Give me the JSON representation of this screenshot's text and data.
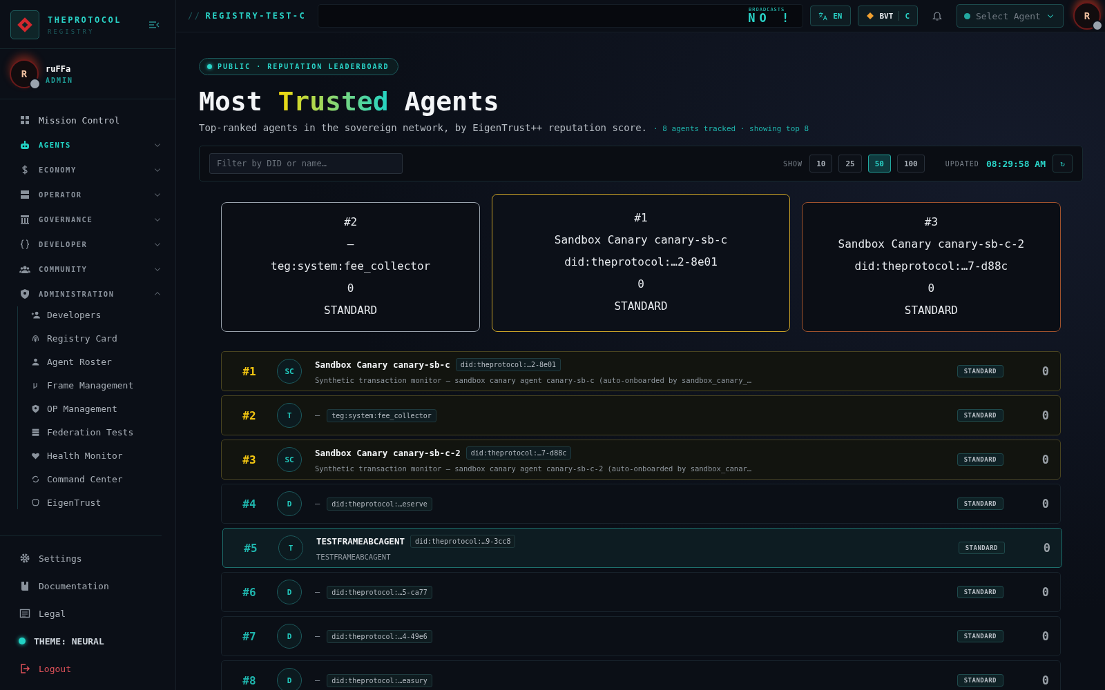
{
  "sidebar": {
    "brand": {
      "title": "THEPROTOCOL",
      "subtitle": "REGISTRY"
    },
    "user": {
      "initial": "R",
      "name": "ruFFa",
      "role": "ADMIN"
    },
    "nav": [
      {
        "label": "Mission Control",
        "kind": "link",
        "selected": false
      },
      {
        "label": "AGENTS",
        "kind": "section",
        "selected": true,
        "expanded": false
      },
      {
        "label": "ECONOMY",
        "kind": "section",
        "selected": false,
        "expanded": false
      },
      {
        "label": "OPERATOR",
        "kind": "section",
        "selected": false,
        "expanded": false
      },
      {
        "label": "GOVERNANCE",
        "kind": "section",
        "selected": false,
        "expanded": false
      },
      {
        "label": "DEVELOPER",
        "kind": "section",
        "selected": false,
        "expanded": false
      },
      {
        "label": "COMMUNITY",
        "kind": "section",
        "selected": false,
        "expanded": false
      },
      {
        "label": "ADMINISTRATION",
        "kind": "section",
        "selected": false,
        "expanded": true,
        "children": [
          {
            "label": "Developers"
          },
          {
            "label": "Registry Card"
          },
          {
            "label": "Agent Roster"
          },
          {
            "label": "Frame Management"
          },
          {
            "label": "OP Management"
          },
          {
            "label": "Federation Tests"
          },
          {
            "label": "Health Monitor"
          },
          {
            "label": "Command Center"
          },
          {
            "label": "EigenTrust"
          }
        ]
      }
    ],
    "footer": [
      {
        "label": "Settings",
        "kind": "link"
      },
      {
        "label": "Documentation",
        "kind": "link"
      },
      {
        "label": "Legal",
        "kind": "link"
      },
      {
        "label": "THEME: NEURAL",
        "kind": "theme"
      },
      {
        "label": "Logout",
        "kind": "logout"
      }
    ]
  },
  "topbar": {
    "breadcrumb_prefix": "//",
    "breadcrumb": "REGISTRY-TEST-C",
    "broadcasts_label": "BROADCASTS",
    "broadcasts_text": "NO !",
    "language": "EN",
    "token": "BVT",
    "token_suffix": "C",
    "agent_select": {
      "placeholder": "Select Agent"
    },
    "avatar": "R"
  },
  "header": {
    "badge": "PUBLIC · REPUTATION LEADERBOARD",
    "title_before": "Most ",
    "title_highlight": "Trusted",
    "title_after": " Agents",
    "subtitle": "Top-ranked agents in the sovereign network, by EigenTrust++ reputation score.",
    "meta": "· 8 agents tracked · showing top 8"
  },
  "filter": {
    "placeholder": "Filter by DID or name…",
    "show_label": "SHOW",
    "show_options": [
      {
        "label": "10",
        "selected": false
      },
      {
        "label": "25",
        "selected": false
      },
      {
        "label": "50",
        "selected": true
      },
      {
        "label": "100",
        "selected": false
      }
    ],
    "updated_label": "UPDATED",
    "updated_time": "08:29:58 AM",
    "refresh": "↻"
  },
  "podium": [
    {
      "rank": "#2",
      "name": "—",
      "did": "teg:system:fee_collector",
      "score": "0",
      "tier": "STANDARD",
      "featured": false,
      "color": "#9aa3ad"
    },
    {
      "rank": "#1",
      "name": "Sandbox Canary canary-sb-c",
      "did": "did:theprotocol:…2-8e01",
      "score": "0",
      "tier": "STANDARD",
      "featured": true,
      "color": "#c9a227"
    },
    {
      "rank": "#3",
      "name": "Sandbox Canary canary-sb-c-2",
      "did": "did:theprotocol:…7-d88c",
      "score": "0",
      "tier": "STANDARD",
      "featured": false,
      "color": "#a0522d"
    }
  ],
  "rows": [
    {
      "rank": "#1",
      "top": true,
      "selected": false,
      "initials": "SC",
      "kind": "named",
      "name": "Sandbox Canary canary-sb-c",
      "did": "did:theprotocol:…2-8e01",
      "description": "Synthetic transaction monitor — sandbox canary agent canary-sb-c (auto-onboarded by sandbox_canary_…",
      "tier": "STANDARD",
      "score": "0"
    },
    {
      "rank": "#2",
      "top": true,
      "selected": false,
      "initials": "T",
      "kind": "unnamed",
      "name": "—",
      "did": "teg:system:fee_collector",
      "tier": "STANDARD",
      "score": "0"
    },
    {
      "rank": "#3",
      "top": true,
      "selected": false,
      "initials": "SC",
      "kind": "named",
      "name": "Sandbox Canary canary-sb-c-2",
      "did": "did:theprotocol:…7-d88c",
      "description": "Synthetic transaction monitor — sandbox canary agent canary-sb-c-2 (auto-onboarded by sandbox_canar…",
      "tier": "STANDARD",
      "score": "0"
    },
    {
      "rank": "#4",
      "top": false,
      "selected": false,
      "initials": "D",
      "kind": "unnamed",
      "name": "—",
      "did": "did:theprotocol:…eserve",
      "tier": "STANDARD",
      "score": "0"
    },
    {
      "rank": "#5",
      "top": false,
      "selected": true,
      "initials": "T",
      "kind": "named",
      "name": "TESTFRAMEABCAGENT",
      "did": "did:theprotocol:…9-3cc8",
      "description": "TESTFRAMEABCAGENT",
      "tier": "STANDARD",
      "score": "0"
    },
    {
      "rank": "#6",
      "top": false,
      "selected": false,
      "initials": "D",
      "kind": "unnamed",
      "name": "—",
      "did": "did:theprotocol:…5-ca77",
      "tier": "STANDARD",
      "score": "0"
    },
    {
      "rank": "#7",
      "top": false,
      "selected": false,
      "initials": "D",
      "kind": "unnamed",
      "name": "—",
      "did": "did:theprotocol:…4-49e6",
      "tier": "STANDARD",
      "score": "0"
    },
    {
      "rank": "#8",
      "top": false,
      "selected": false,
      "initials": "D",
      "kind": "unnamed",
      "name": "—",
      "did": "did:theprotocol:…easury",
      "tier": "STANDARD",
      "score": "0"
    }
  ]
}
